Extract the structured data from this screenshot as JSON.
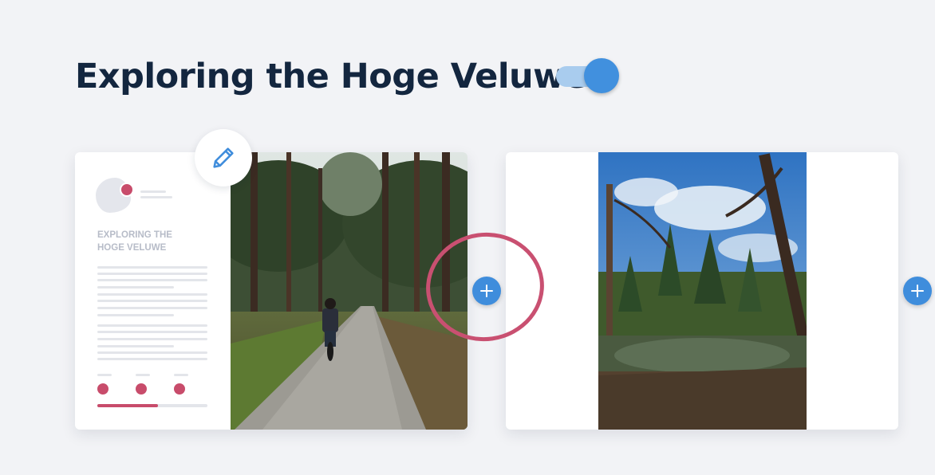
{
  "header": {
    "title": "Exploring the Hoge Veluwe",
    "toggle_on": true
  },
  "pages": [
    {
      "heading": "EXPLORING THE\nHOGE VELUWE",
      "photo": "forest-path-cyclist-photo",
      "progress": 0.55
    },
    {
      "photo": "forest-pond-photo"
    }
  ],
  "icons": {
    "edit": "pencil-icon",
    "add": "plus-icon"
  },
  "colors": {
    "accent_blue": "#3f8ddc",
    "accent_red": "#c84c6b",
    "title": "#13263f"
  }
}
